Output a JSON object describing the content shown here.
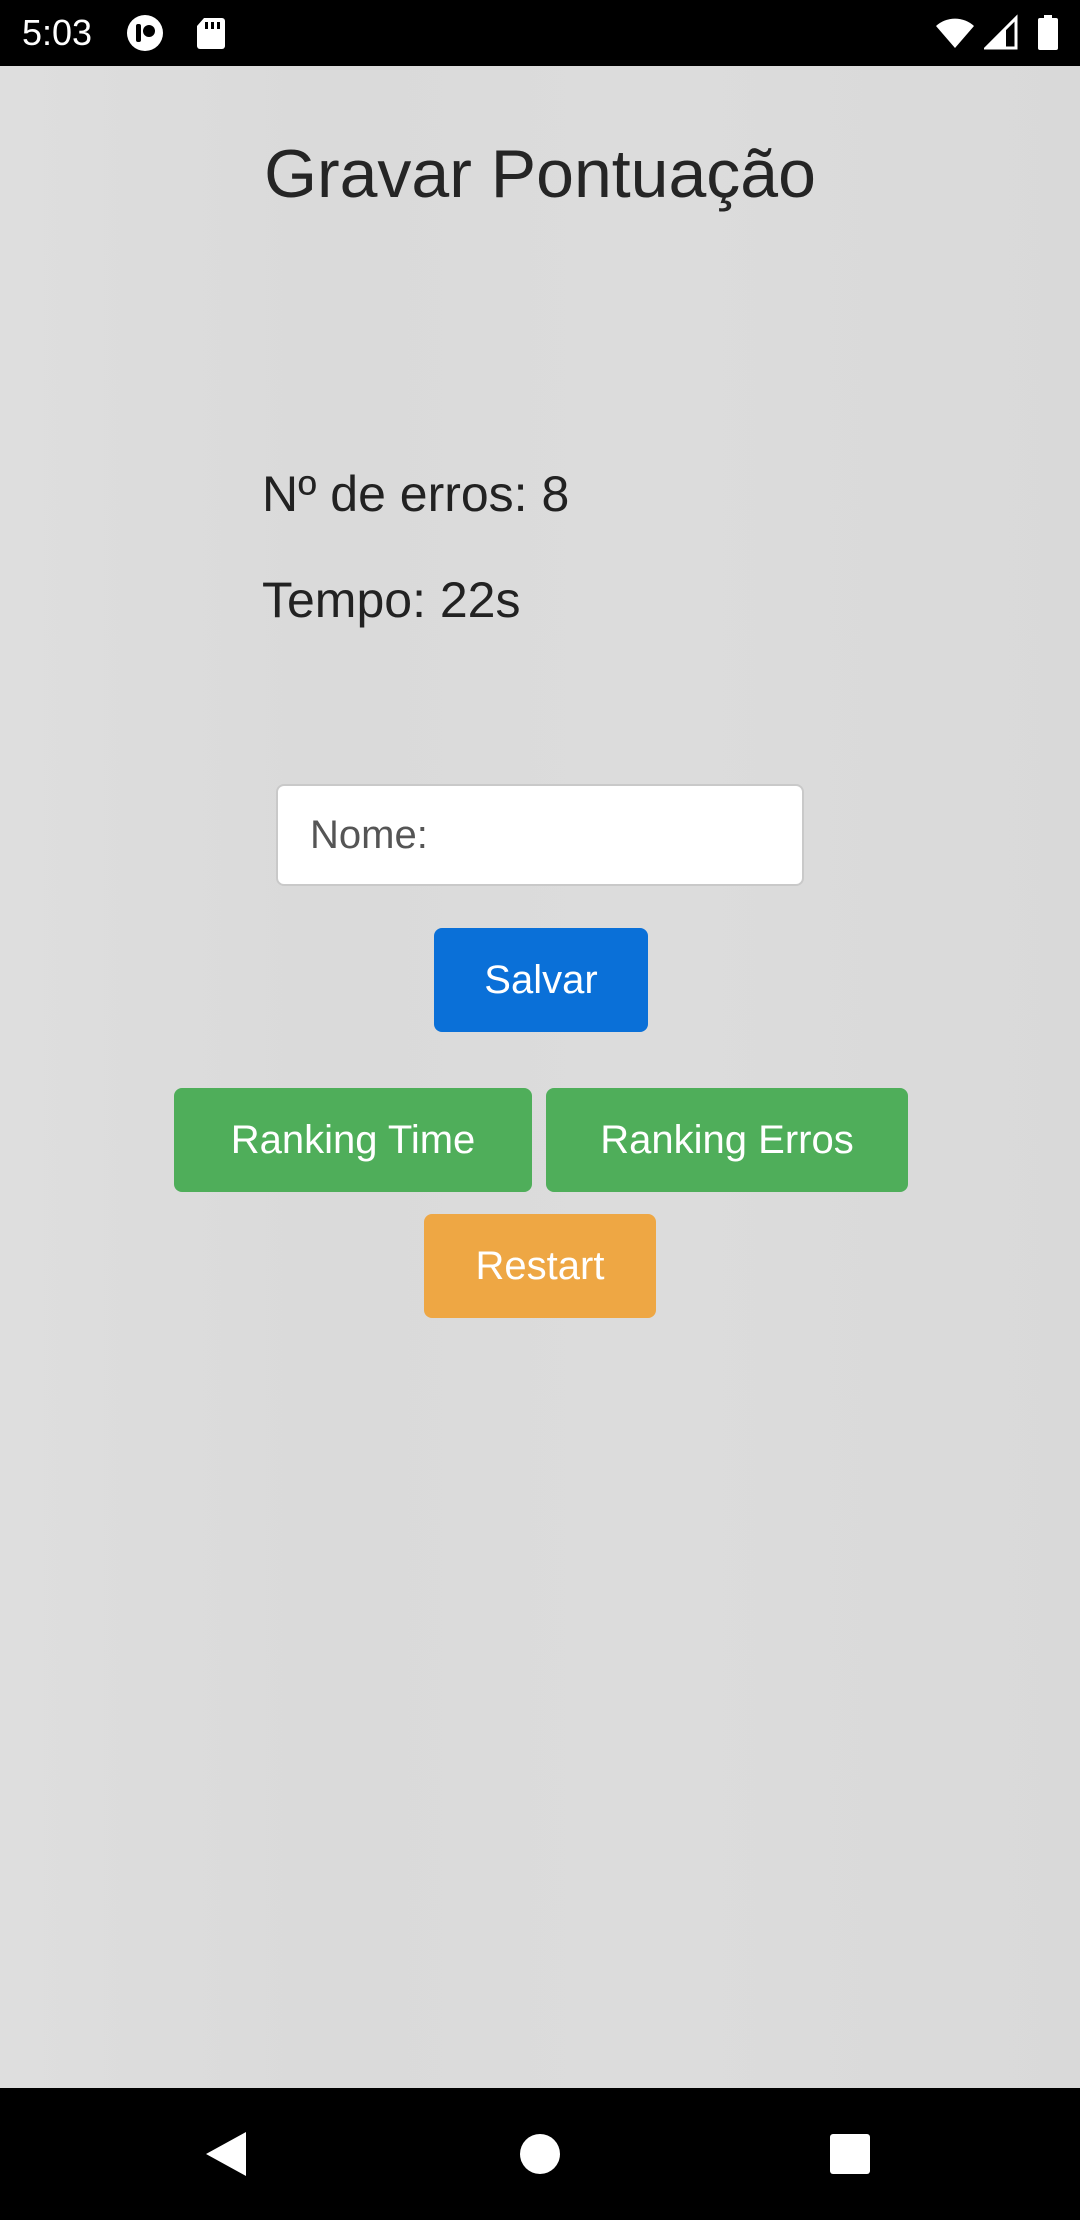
{
  "status_bar": {
    "time": "5:03",
    "icons": [
      "notification-icon",
      "sd-card-icon",
      "wifi-icon",
      "signal-icon",
      "battery-icon"
    ]
  },
  "page": {
    "title": "Gravar Pontuação",
    "errors_label": "Nº de erros: 8",
    "time_label": "Tempo: 22s"
  },
  "form": {
    "name_placeholder": "Nome:",
    "name_value": "",
    "save_label": "Salvar"
  },
  "actions": {
    "ranking_time_label": "Ranking Time",
    "ranking_errors_label": "Ranking Erros",
    "restart_label": "Restart"
  },
  "nav_bar": {
    "icons": [
      "back-icon",
      "home-icon",
      "recents-icon"
    ]
  },
  "colors": {
    "background": "#dcdcdc",
    "primary": "#0a70d8",
    "success": "#4fae5a",
    "warning": "#eea744"
  }
}
